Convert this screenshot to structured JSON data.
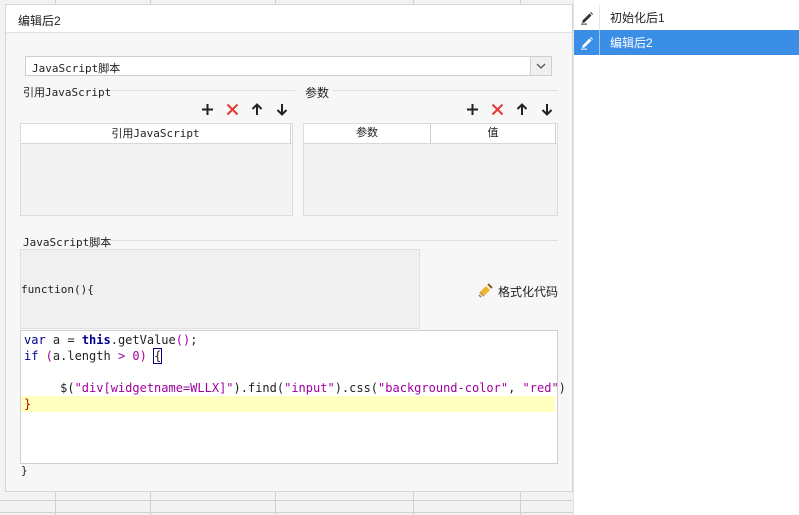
{
  "dialog": {
    "title": "编辑后2"
  },
  "script_type": {
    "value": "JavaScript脚本"
  },
  "ref_section": {
    "title": "引用JavaScript",
    "column": "引用JavaScript",
    "tools": [
      "add-icon",
      "delete-icon",
      "move-up-icon",
      "move-down-icon"
    ]
  },
  "param_section": {
    "title": "参数",
    "columns": [
      "参数",
      "值"
    ],
    "tools": [
      "add-icon",
      "delete-icon",
      "move-up-icon",
      "move-down-icon"
    ]
  },
  "script_section": {
    "title": "JavaScript脚本",
    "prefix": "function(){",
    "suffix": "}",
    "format_label": "格式化代码",
    "code": {
      "l1_kw": "var",
      "l1_a": " a = ",
      "l1_this": "this",
      "l1_b": ".getValue",
      "l1_paren": "()",
      "l1_c": ";",
      "l2_kw": "if",
      "l2_open": " (",
      "l2_a": "a.length ",
      "l2_op": ">",
      "l2_sp": " ",
      "l2_num": "0",
      "l2_close": ")",
      "l2_sp2": " ",
      "l2_brace": "{",
      "l4_indent": "     ",
      "l4_a": "$(",
      "l4_s1": "\"div[widgetname=WLLX]\"",
      "l4_b": ").find(",
      "l4_s2": "\"input\"",
      "l4_c": ").css(",
      "l4_s3": "\"background-color\"",
      "l4_d": ", ",
      "l4_s4": "\"red\"",
      "l4_e": ")",
      "l5_brace": "}"
    }
  },
  "right_panel": {
    "items": [
      {
        "label": "初始化后1",
        "icon": "edit-icon",
        "active": false
      },
      {
        "label": "编辑后2",
        "icon": "edit-icon",
        "active": true
      }
    ]
  },
  "colors": {
    "accent": "#3a8ee6",
    "delete": "#e53935",
    "highlight": "#ffffc0"
  }
}
